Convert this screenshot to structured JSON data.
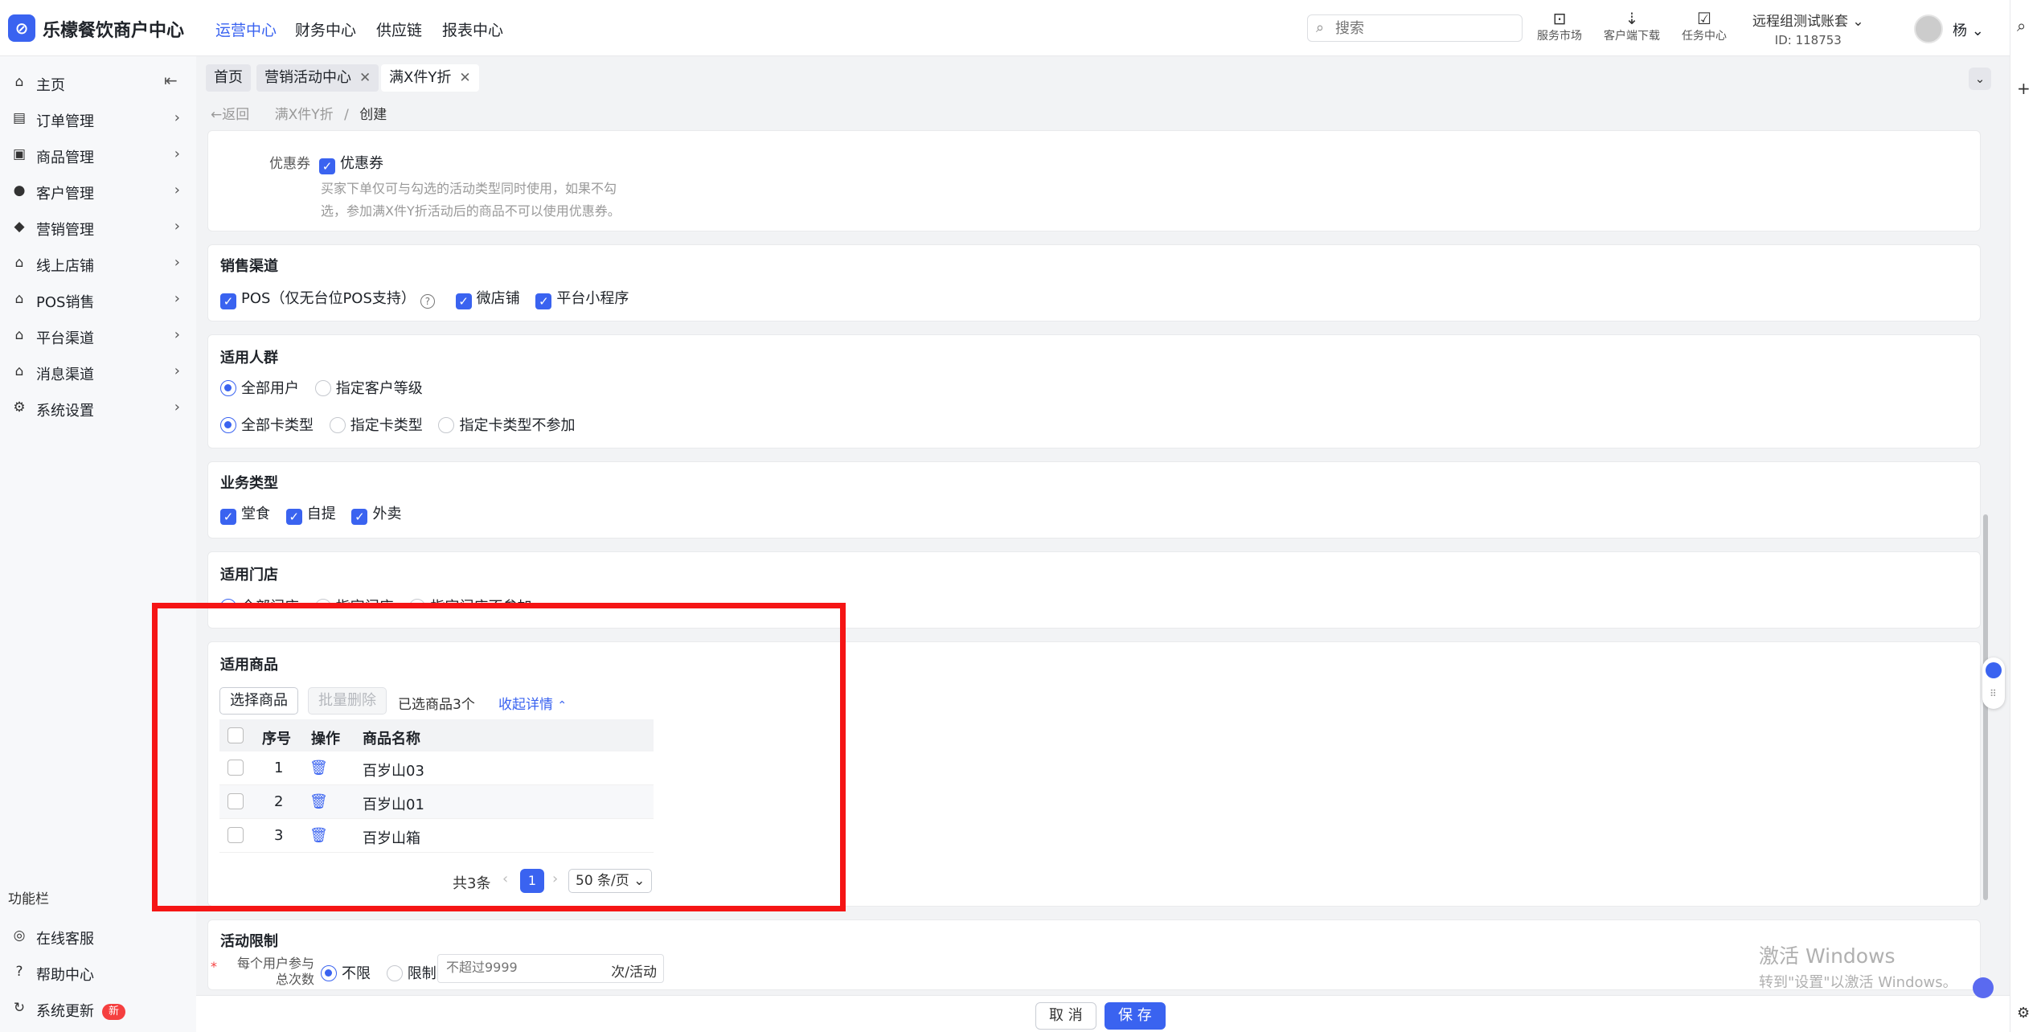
{
  "topbar": {
    "logo_glyph": "⊘",
    "brand": "乐檬餐饮商户中心",
    "nav": [
      "运营中心",
      "财务中心",
      "供应链",
      "报表中心"
    ],
    "active_nav": "运营中心",
    "search_placeholder": "搜索",
    "tools": [
      {
        "icon": "store-icon",
        "label": "服务市场"
      },
      {
        "icon": "download-folder-icon",
        "label": "客户端下载"
      },
      {
        "icon": "task-icon",
        "label": "任务中心"
      }
    ],
    "account_name": "远程组测试账套",
    "account_id": "ID: 118753",
    "user": "杨"
  },
  "sidebar": {
    "items": [
      {
        "icon": "home-icon",
        "label": "主页"
      },
      {
        "icon": "order-icon",
        "label": "订单管理"
      },
      {
        "icon": "product-icon",
        "label": "商品管理"
      },
      {
        "icon": "customer-icon",
        "label": "客户管理"
      },
      {
        "icon": "marketing-icon",
        "label": "营销管理"
      },
      {
        "icon": "online-store-icon",
        "label": "线上店铺"
      },
      {
        "icon": "pos-icon",
        "label": "POS销售"
      },
      {
        "icon": "platform-icon",
        "label": "平台渠道"
      },
      {
        "icon": "message-icon",
        "label": "消息渠道"
      },
      {
        "icon": "settings-icon",
        "label": "系统设置"
      }
    ],
    "function_heading": "功能栏",
    "function_items": [
      {
        "icon": "customer-service-icon",
        "label": "在线客服"
      },
      {
        "icon": "help-icon",
        "label": "帮助中心"
      },
      {
        "icon": "update-icon",
        "label": "系统更新",
        "badge": "新"
      }
    ]
  },
  "tabs": [
    {
      "label": "首页",
      "closable": false
    },
    {
      "label": "营销活动中心",
      "closable": true
    },
    {
      "label": "满X件Y折",
      "closable": true,
      "active": true
    }
  ],
  "breadcrumb": {
    "back": "返回",
    "parent": "满X件Y折",
    "sep": "/",
    "current": "创建"
  },
  "coupon": {
    "label": "优惠券",
    "checkbox_label": "优惠券",
    "hint_line1": "买家下单仅可与勾选的活动类型同时使用，如果不勾",
    "hint_line2": "选，参加满X件Y折活动后的商品不可以使用优惠券。"
  },
  "sales_channel": {
    "title": "销售渠道",
    "options": [
      "POS（仅无台位POS支持）",
      "微店铺",
      "平台小程序"
    ]
  },
  "audience": {
    "title": "适用人群",
    "row1": [
      "全部用户",
      "指定客户等级"
    ],
    "row2": [
      "全部卡类型",
      "指定卡类型",
      "指定卡类型不参加"
    ]
  },
  "business_type": {
    "title": "业务类型",
    "options": [
      "堂食",
      "自提",
      "外卖"
    ]
  },
  "stores": {
    "title": "适用门店",
    "options": [
      "全部门店",
      "指定门店",
      "指定门店不参加"
    ]
  },
  "products": {
    "title": "适用商品",
    "select_btn": "选择商品",
    "batch_delete_btn": "批量删除",
    "selected_count": "已选商品3个",
    "collapse_link": "收起详情",
    "columns": [
      "序号",
      "操作",
      "商品名称"
    ],
    "rows": [
      {
        "no": "1",
        "name": "百岁山03"
      },
      {
        "no": "2",
        "name": "百岁山01"
      },
      {
        "no": "3",
        "name": "百岁山箱"
      }
    ],
    "total": "共3条",
    "current_page": "1",
    "page_size": "50 条/页"
  },
  "limit": {
    "title": "活动限制",
    "required_mark": "*",
    "label_line1": "每个用户参与",
    "label_line2": "总次数",
    "options": [
      "不限",
      "限制"
    ],
    "input_placeholder": "不超过9999",
    "unit": "次/活动"
  },
  "footer": {
    "cancel": "取 消",
    "save": "保 存"
  },
  "watermark": {
    "line1": "激活 Windows",
    "line2": "转到\"设置\"以激活 Windows。"
  },
  "colors": {
    "accent": "#3a63f0",
    "highlight_border": "#f51515",
    "badge": "#f53f3f"
  }
}
